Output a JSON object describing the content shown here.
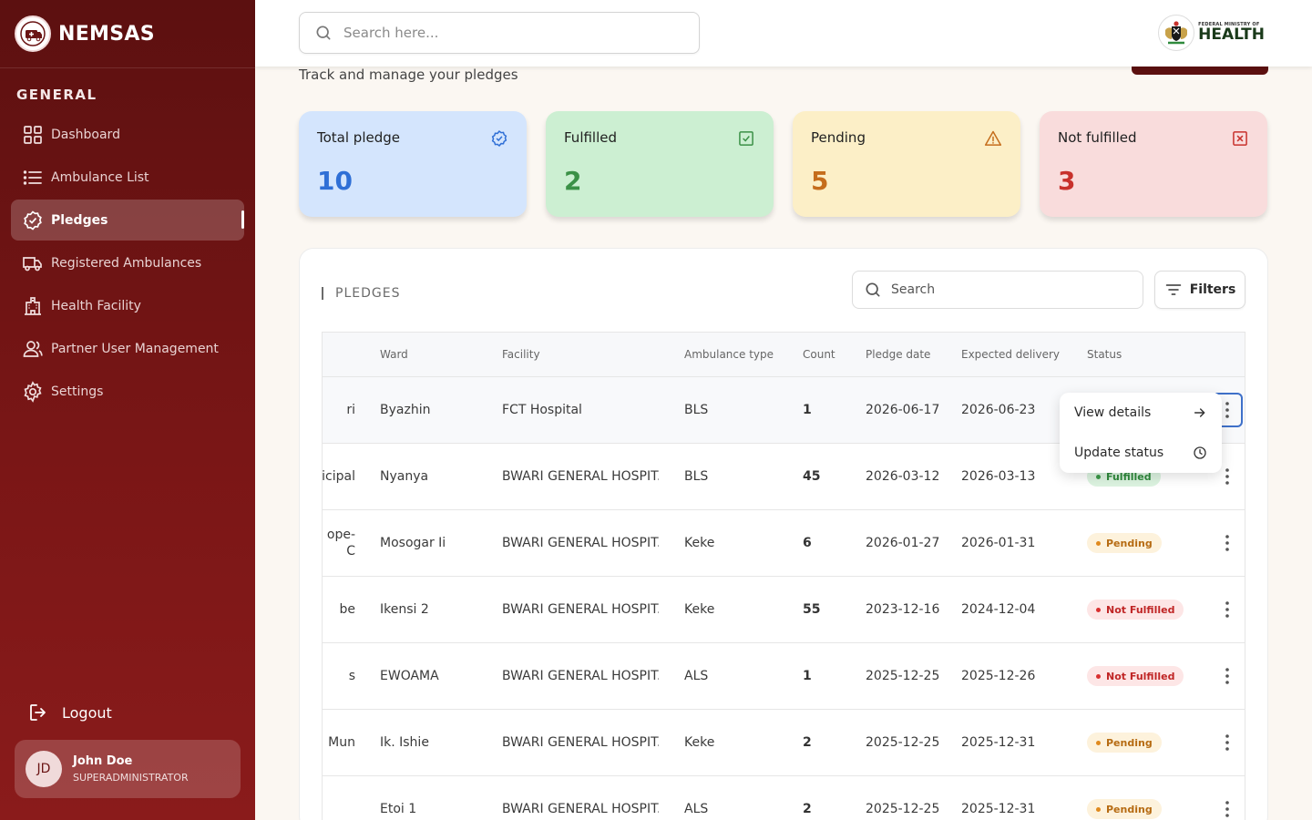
{
  "brand": {
    "name": "NEMSAS",
    "logo_icon": "ambulance-logo-icon"
  },
  "sidebar": {
    "section_label": "GENERAL",
    "items": [
      {
        "label": "Dashboard",
        "icon": "grid-icon",
        "active": false
      },
      {
        "label": "Ambulance List",
        "icon": "list-icon",
        "active": false
      },
      {
        "label": "Pledges",
        "icon": "badge-check-icon",
        "active": true
      },
      {
        "label": "Registered Ambulances",
        "icon": "truck-icon",
        "active": false
      },
      {
        "label": "Health Facility",
        "icon": "building-icon",
        "active": false
      },
      {
        "label": "Partner User Management",
        "icon": "users-icon",
        "active": false
      },
      {
        "label": "Settings",
        "icon": "gear-icon",
        "active": false
      }
    ],
    "logout_label": "Logout",
    "user": {
      "initials": "JD",
      "name": "John Doe",
      "role": "SUPERADMINISTRATOR"
    }
  },
  "header": {
    "search_placeholder": "Search here...",
    "ministry": {
      "small": "FEDERAL MINISTRY OF",
      "big": "HEALTH"
    }
  },
  "page": {
    "subtitle": "Track and manage your pledges"
  },
  "stats": [
    {
      "label": "Total pledge",
      "value": "10",
      "icon": "badge-check-icon",
      "color": "#2f6fd6"
    },
    {
      "label": "Fulfilled",
      "value": "2",
      "icon": "checkbox-icon",
      "color": "#3b9147"
    },
    {
      "label": "Pending",
      "value": "5",
      "icon": "warning-icon",
      "color": "#c56d1c"
    },
    {
      "label": "Not fulfilled",
      "value": "3",
      "icon": "x-box-icon",
      "color": "#c8312c"
    }
  ],
  "table": {
    "title": "PLEDGES",
    "search_placeholder": "Search",
    "filters_label": "Filters",
    "columns": [
      "Ward",
      "Facility",
      "Ambulance type",
      "Count",
      "Pledge date",
      "Expected delivery",
      "Status"
    ],
    "rows": [
      {
        "partial": "ri",
        "ward": "Byazhin",
        "facility": "FCT Hospital",
        "type": "BLS",
        "count": "1",
        "pledge_date": "2026-06-17",
        "expected": "2026-06-23",
        "status": "",
        "status_kind": ""
      },
      {
        "partial": "icipal",
        "ward": "Nyanya",
        "facility": "BWARI GENERAL HOSPIT...",
        "type": "BLS",
        "count": "45",
        "pledge_date": "2026-03-12",
        "expected": "2026-03-13",
        "status": "Fulfilled",
        "status_kind": "ful"
      },
      {
        "partial": "ope-\nC",
        "ward": "Mosogar Ii",
        "facility": "BWARI GENERAL HOSPIT...",
        "type": "Keke",
        "count": "6",
        "pledge_date": "2026-01-27",
        "expected": "2026-01-31",
        "status": "Pending",
        "status_kind": "pending"
      },
      {
        "partial": "be",
        "ward": "Ikensi 2",
        "facility": "BWARI GENERAL HOSPIT...",
        "type": "Keke",
        "count": "55",
        "pledge_date": "2023-12-16",
        "expected": "2024-12-04",
        "status": "Not Fulfilled",
        "status_kind": "nf"
      },
      {
        "partial": "s",
        "ward": "EWOAMA",
        "facility": "BWARI GENERAL HOSPIT...",
        "type": "ALS",
        "count": "1",
        "pledge_date": "2025-12-25",
        "expected": "2025-12-26",
        "status": "Not Fulfilled",
        "status_kind": "nf"
      },
      {
        "partial": "Mun",
        "ward": "Ik. Ishie",
        "facility": "BWARI GENERAL HOSPIT...",
        "type": "Keke",
        "count": "2",
        "pledge_date": "2025-12-25",
        "expected": "2025-12-31",
        "status": "Pending",
        "status_kind": "pending"
      },
      {
        "partial": "",
        "ward": "Etoi 1",
        "facility": "BWARI GENERAL HOSPIT...",
        "type": "ALS",
        "count": "2",
        "pledge_date": "2025-12-25",
        "expected": "2025-12-31",
        "status": "Pending",
        "status_kind": "pending"
      }
    ]
  },
  "row_menu": {
    "items": [
      {
        "label": "View details",
        "icon": "arrow-right-icon"
      },
      {
        "label": "Update status",
        "icon": "clock-icon"
      }
    ]
  }
}
